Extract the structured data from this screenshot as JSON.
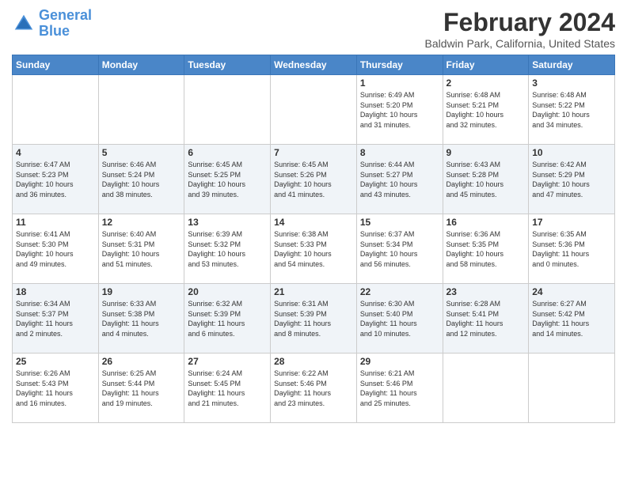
{
  "header": {
    "logo_line1": "General",
    "logo_line2": "Blue",
    "title": "February 2024",
    "subtitle": "Baldwin Park, California, United States"
  },
  "columns": [
    "Sunday",
    "Monday",
    "Tuesday",
    "Wednesday",
    "Thursday",
    "Friday",
    "Saturday"
  ],
  "weeks": [
    [
      {
        "day": "",
        "info": ""
      },
      {
        "day": "",
        "info": ""
      },
      {
        "day": "",
        "info": ""
      },
      {
        "day": "",
        "info": ""
      },
      {
        "day": "1",
        "info": "Sunrise: 6:49 AM\nSunset: 5:20 PM\nDaylight: 10 hours\nand 31 minutes."
      },
      {
        "day": "2",
        "info": "Sunrise: 6:48 AM\nSunset: 5:21 PM\nDaylight: 10 hours\nand 32 minutes."
      },
      {
        "day": "3",
        "info": "Sunrise: 6:48 AM\nSunset: 5:22 PM\nDaylight: 10 hours\nand 34 minutes."
      }
    ],
    [
      {
        "day": "4",
        "info": "Sunrise: 6:47 AM\nSunset: 5:23 PM\nDaylight: 10 hours\nand 36 minutes."
      },
      {
        "day": "5",
        "info": "Sunrise: 6:46 AM\nSunset: 5:24 PM\nDaylight: 10 hours\nand 38 minutes."
      },
      {
        "day": "6",
        "info": "Sunrise: 6:45 AM\nSunset: 5:25 PM\nDaylight: 10 hours\nand 39 minutes."
      },
      {
        "day": "7",
        "info": "Sunrise: 6:45 AM\nSunset: 5:26 PM\nDaylight: 10 hours\nand 41 minutes."
      },
      {
        "day": "8",
        "info": "Sunrise: 6:44 AM\nSunset: 5:27 PM\nDaylight: 10 hours\nand 43 minutes."
      },
      {
        "day": "9",
        "info": "Sunrise: 6:43 AM\nSunset: 5:28 PM\nDaylight: 10 hours\nand 45 minutes."
      },
      {
        "day": "10",
        "info": "Sunrise: 6:42 AM\nSunset: 5:29 PM\nDaylight: 10 hours\nand 47 minutes."
      }
    ],
    [
      {
        "day": "11",
        "info": "Sunrise: 6:41 AM\nSunset: 5:30 PM\nDaylight: 10 hours\nand 49 minutes."
      },
      {
        "day": "12",
        "info": "Sunrise: 6:40 AM\nSunset: 5:31 PM\nDaylight: 10 hours\nand 51 minutes."
      },
      {
        "day": "13",
        "info": "Sunrise: 6:39 AM\nSunset: 5:32 PM\nDaylight: 10 hours\nand 53 minutes."
      },
      {
        "day": "14",
        "info": "Sunrise: 6:38 AM\nSunset: 5:33 PM\nDaylight: 10 hours\nand 54 minutes."
      },
      {
        "day": "15",
        "info": "Sunrise: 6:37 AM\nSunset: 5:34 PM\nDaylight: 10 hours\nand 56 minutes."
      },
      {
        "day": "16",
        "info": "Sunrise: 6:36 AM\nSunset: 5:35 PM\nDaylight: 10 hours\nand 58 minutes."
      },
      {
        "day": "17",
        "info": "Sunrise: 6:35 AM\nSunset: 5:36 PM\nDaylight: 11 hours\nand 0 minutes."
      }
    ],
    [
      {
        "day": "18",
        "info": "Sunrise: 6:34 AM\nSunset: 5:37 PM\nDaylight: 11 hours\nand 2 minutes."
      },
      {
        "day": "19",
        "info": "Sunrise: 6:33 AM\nSunset: 5:38 PM\nDaylight: 11 hours\nand 4 minutes."
      },
      {
        "day": "20",
        "info": "Sunrise: 6:32 AM\nSunset: 5:39 PM\nDaylight: 11 hours\nand 6 minutes."
      },
      {
        "day": "21",
        "info": "Sunrise: 6:31 AM\nSunset: 5:39 PM\nDaylight: 11 hours\nand 8 minutes."
      },
      {
        "day": "22",
        "info": "Sunrise: 6:30 AM\nSunset: 5:40 PM\nDaylight: 11 hours\nand 10 minutes."
      },
      {
        "day": "23",
        "info": "Sunrise: 6:28 AM\nSunset: 5:41 PM\nDaylight: 11 hours\nand 12 minutes."
      },
      {
        "day": "24",
        "info": "Sunrise: 6:27 AM\nSunset: 5:42 PM\nDaylight: 11 hours\nand 14 minutes."
      }
    ],
    [
      {
        "day": "25",
        "info": "Sunrise: 6:26 AM\nSunset: 5:43 PM\nDaylight: 11 hours\nand 16 minutes."
      },
      {
        "day": "26",
        "info": "Sunrise: 6:25 AM\nSunset: 5:44 PM\nDaylight: 11 hours\nand 19 minutes."
      },
      {
        "day": "27",
        "info": "Sunrise: 6:24 AM\nSunset: 5:45 PM\nDaylight: 11 hours\nand 21 minutes."
      },
      {
        "day": "28",
        "info": "Sunrise: 6:22 AM\nSunset: 5:46 PM\nDaylight: 11 hours\nand 23 minutes."
      },
      {
        "day": "29",
        "info": "Sunrise: 6:21 AM\nSunset: 5:46 PM\nDaylight: 11 hours\nand 25 minutes."
      },
      {
        "day": "",
        "info": ""
      },
      {
        "day": "",
        "info": ""
      }
    ]
  ]
}
